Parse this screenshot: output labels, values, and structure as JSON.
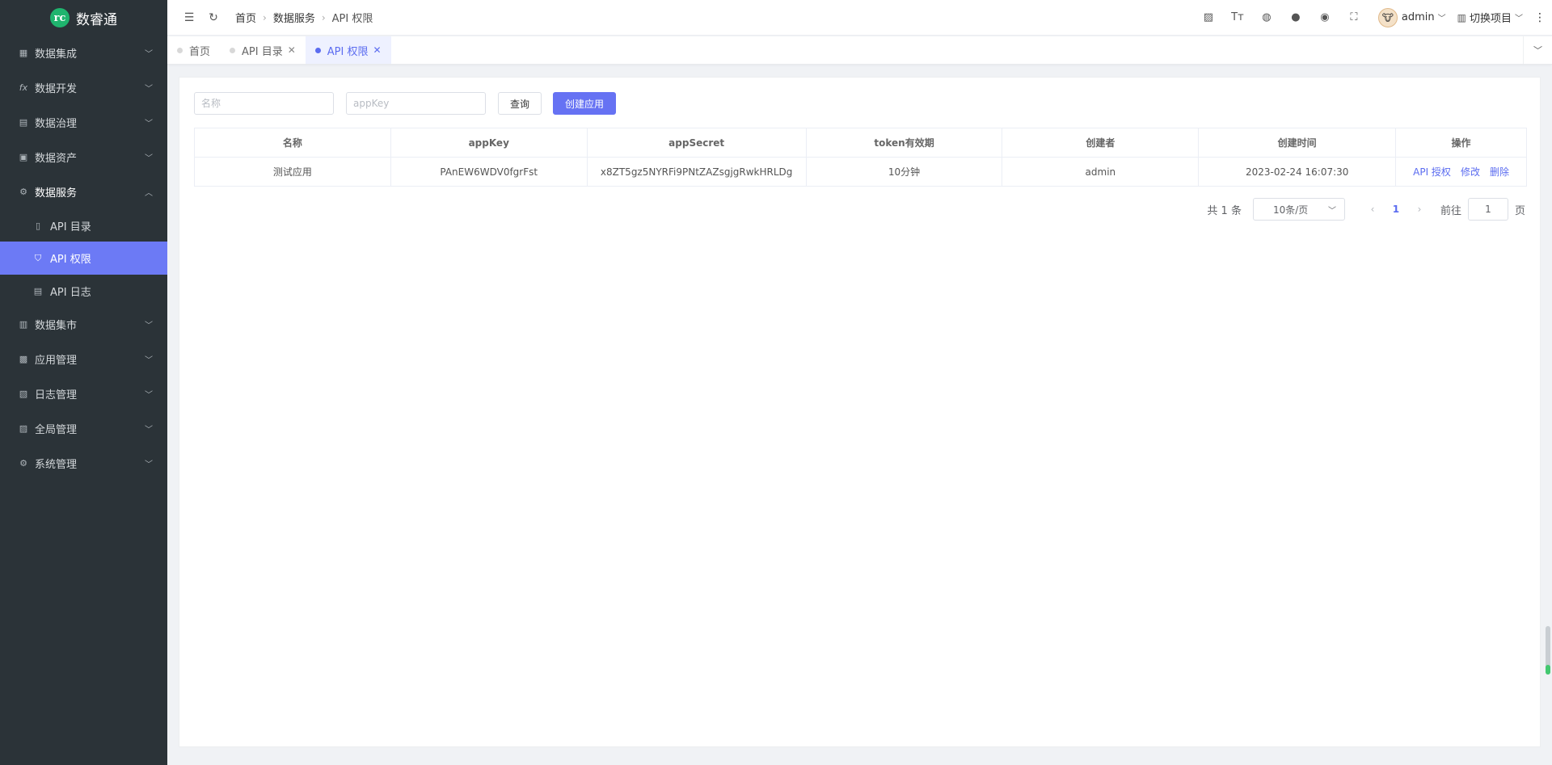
{
  "app": {
    "logo_text": "数睿通",
    "logo_mark": "rc"
  },
  "sidebar": {
    "items": [
      {
        "label": "数据集成",
        "icon": "▦"
      },
      {
        "label": "数据开发",
        "icon": "fx"
      },
      {
        "label": "数据治理",
        "icon": "▤"
      },
      {
        "label": "数据资产",
        "icon": "▣"
      },
      {
        "label": "数据服务",
        "icon": "⚙"
      },
      {
        "label": "数据集市",
        "icon": "▥"
      },
      {
        "label": "应用管理",
        "icon": "▩"
      },
      {
        "label": "日志管理",
        "icon": "▧"
      },
      {
        "label": "全局管理",
        "icon": "▨"
      },
      {
        "label": "系统管理",
        "icon": "⚙"
      }
    ],
    "sub_items": [
      {
        "label": "API 目录",
        "icon": "▯"
      },
      {
        "label": "API 权限",
        "icon": "⛉"
      },
      {
        "label": "API 日志",
        "icon": "▤"
      }
    ]
  },
  "header": {
    "breadcrumb": [
      "首页",
      "数据服务",
      "API 权限"
    ],
    "user": "admin",
    "switch_project": "切换项目"
  },
  "tabs": [
    {
      "label": "首页"
    },
    {
      "label": "API 目录"
    },
    {
      "label": "API 权限"
    }
  ],
  "filters": {
    "name_placeholder": "名称",
    "appkey_placeholder": "appKey",
    "query_label": "查询",
    "create_label": "创建应用"
  },
  "table": {
    "columns": [
      "名称",
      "appKey",
      "appSecret",
      "token有效期",
      "创建者",
      "创建时间",
      "操作"
    ],
    "rows": [
      {
        "name": "测试应用",
        "appKey": "PAnEW6WDV0fgrFst",
        "appSecret": "x8ZT5gz5NYRFi9PNtZAZsgjgRwkHRLDg",
        "token": "10分钟",
        "creator": "admin",
        "created": "2023-02-24 16:07:30",
        "actions": [
          "API 授权",
          "修改",
          "删除"
        ]
      }
    ]
  },
  "pagination": {
    "total": "共 1 条",
    "page_size": "10条/页",
    "current_page": "1",
    "goto_prefix": "前往",
    "goto_value": "1",
    "goto_suffix": "页"
  },
  "colors": {
    "accent": "#6672f3",
    "sidebar_bg": "#2b3338",
    "logo": "#1fb46e"
  }
}
